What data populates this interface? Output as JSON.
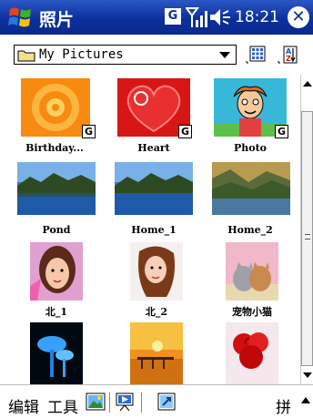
{
  "titlebar": {
    "app_title": "照片",
    "network_label": "G",
    "time": "18:21"
  },
  "folderbar": {
    "folder_name": "My Pictures"
  },
  "thumbnails": [
    {
      "label": "Birthday...",
      "badge": "G"
    },
    {
      "label": "Heart",
      "badge": "G"
    },
    {
      "label": "Photo",
      "badge": "G"
    },
    {
      "label": "Pond"
    },
    {
      "label": "Home_1"
    },
    {
      "label": "Home_2"
    },
    {
      "label": "北_1"
    },
    {
      "label": "北_2"
    },
    {
      "label": "宠物小猫"
    },
    {
      "label": ""
    },
    {
      "label": ""
    },
    {
      "label": ""
    }
  ],
  "menubar": {
    "edit": "编辑",
    "tools": "工具",
    "ime": "拼"
  }
}
